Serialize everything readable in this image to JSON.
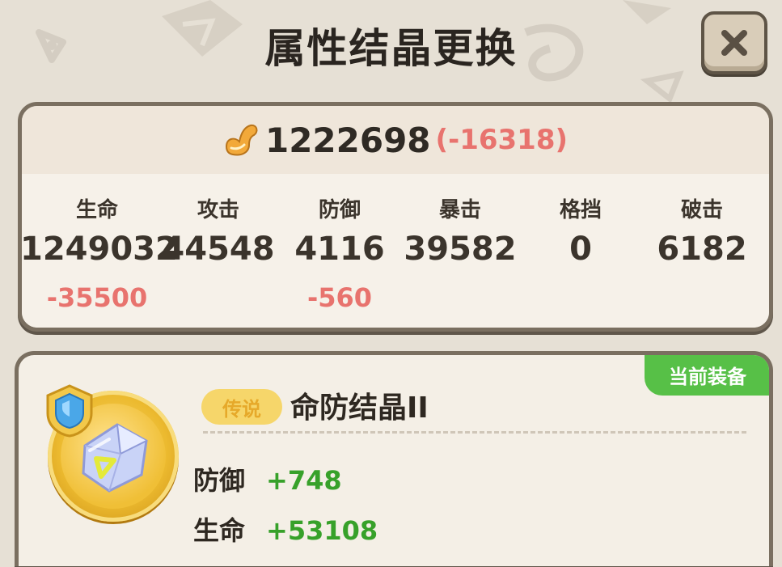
{
  "dialog": {
    "title": "属性结晶更换"
  },
  "power": {
    "icon": "flexed-arm-icon",
    "value": "1222698",
    "delta": "(-16318)"
  },
  "stats": [
    {
      "label": "生命",
      "value": "1249032",
      "delta": "-35500"
    },
    {
      "label": "攻击",
      "value": "44548",
      "delta": ""
    },
    {
      "label": "防御",
      "value": "4116",
      "delta": "-560"
    },
    {
      "label": "暴击",
      "value": "39582",
      "delta": ""
    },
    {
      "label": "格挡",
      "value": "0",
      "delta": ""
    },
    {
      "label": "破击",
      "value": "6182",
      "delta": ""
    }
  ],
  "crystal": {
    "badge": "当前装备",
    "rarity": "传说",
    "name": "命防结晶II",
    "attributes": [
      {
        "name": "防御",
        "value": "+748"
      },
      {
        "name": "生命",
        "value": "+53108"
      }
    ]
  },
  "colors": {
    "negative": "#e8736e",
    "positive": "#37a12a",
    "equipped": "#57c047",
    "gold": "#ecba2f"
  }
}
